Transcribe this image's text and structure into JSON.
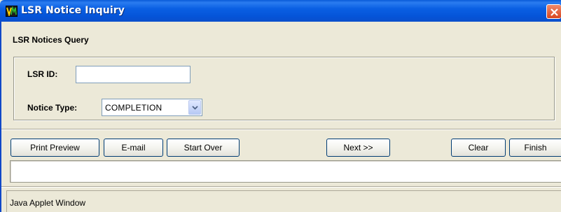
{
  "window": {
    "title": "LSR Notice Inquiry",
    "icon": "app-logo-icon",
    "close_icon": "close-icon"
  },
  "query": {
    "section_title": "LSR Notices Query",
    "lsr_id_label": "LSR ID:",
    "lsr_id_value": "",
    "notice_type_label": "Notice Type:",
    "notice_type_value": "COMPLETION"
  },
  "buttons": {
    "print_preview": "Print Preview",
    "email": "E-mail",
    "start_over": "Start Over",
    "next": "Next >>",
    "clear": "Clear",
    "finish": "Finish"
  },
  "message": {
    "value": ""
  },
  "status": {
    "text": "Java Applet Window"
  },
  "colors": {
    "titlebar": "#0a5fe3",
    "background": "#ece9d8",
    "close_button": "#d8461f"
  }
}
